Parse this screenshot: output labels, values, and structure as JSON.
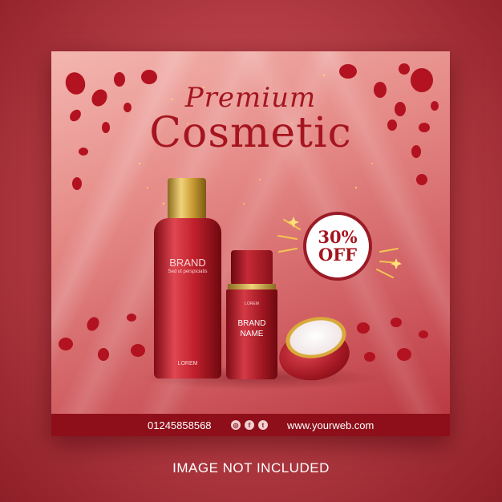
{
  "headline": {
    "line1": "Premium",
    "line2": "Cosmetic"
  },
  "badge": {
    "percent": "30%",
    "label": "OFF"
  },
  "products": {
    "bottle_brand": "BRAND",
    "bottle_subtext": "Sed ut perspiciatis",
    "bottle_bottom": "LOREM",
    "serum_brand": "BRAND",
    "serum_name": "NAME",
    "serum_bottom": "LOREM"
  },
  "footer": {
    "phone": "01245858568",
    "website": "www.yourweb.com",
    "social_icons": [
      "instagram-icon",
      "facebook-icon",
      "twitter-icon"
    ]
  },
  "caption": "IMAGE NOT INCLUDED",
  "colors": {
    "primary": "#a5151f",
    "footer_bg": "#8e0f1a",
    "gold": "#d9a93a"
  }
}
